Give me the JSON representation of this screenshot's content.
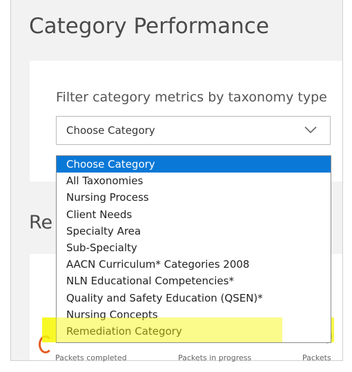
{
  "page": {
    "title": "Category Performance"
  },
  "filter": {
    "label": "Filter category metrics by taxonomy type",
    "select_value": "Choose Category",
    "options": [
      "Choose Category",
      "All Taxonomies",
      "Nursing Process",
      "Client Needs",
      "Specialty Area",
      "Sub-Specialty",
      "AACN Curriculum* Categories 2008",
      "NLN Educational Competencies*",
      "Quality and Safety Education (QSEN)*",
      "Nursing Concepts",
      "Remediation Category"
    ],
    "selected_index": 0,
    "highlighted_option": "Remediation Category",
    "highlight_color": "#f6f600"
  },
  "section": {
    "heading_partial": "Re"
  },
  "metrics": {
    "big_digit_partial": "0",
    "labels": [
      "Packets completed",
      "Packets in progress",
      "Packets"
    ]
  },
  "colors": {
    "selected_option_bg": "#0a78d7",
    "accent_orange": "#e35b24",
    "panel_bg": "#f2f2f2"
  }
}
